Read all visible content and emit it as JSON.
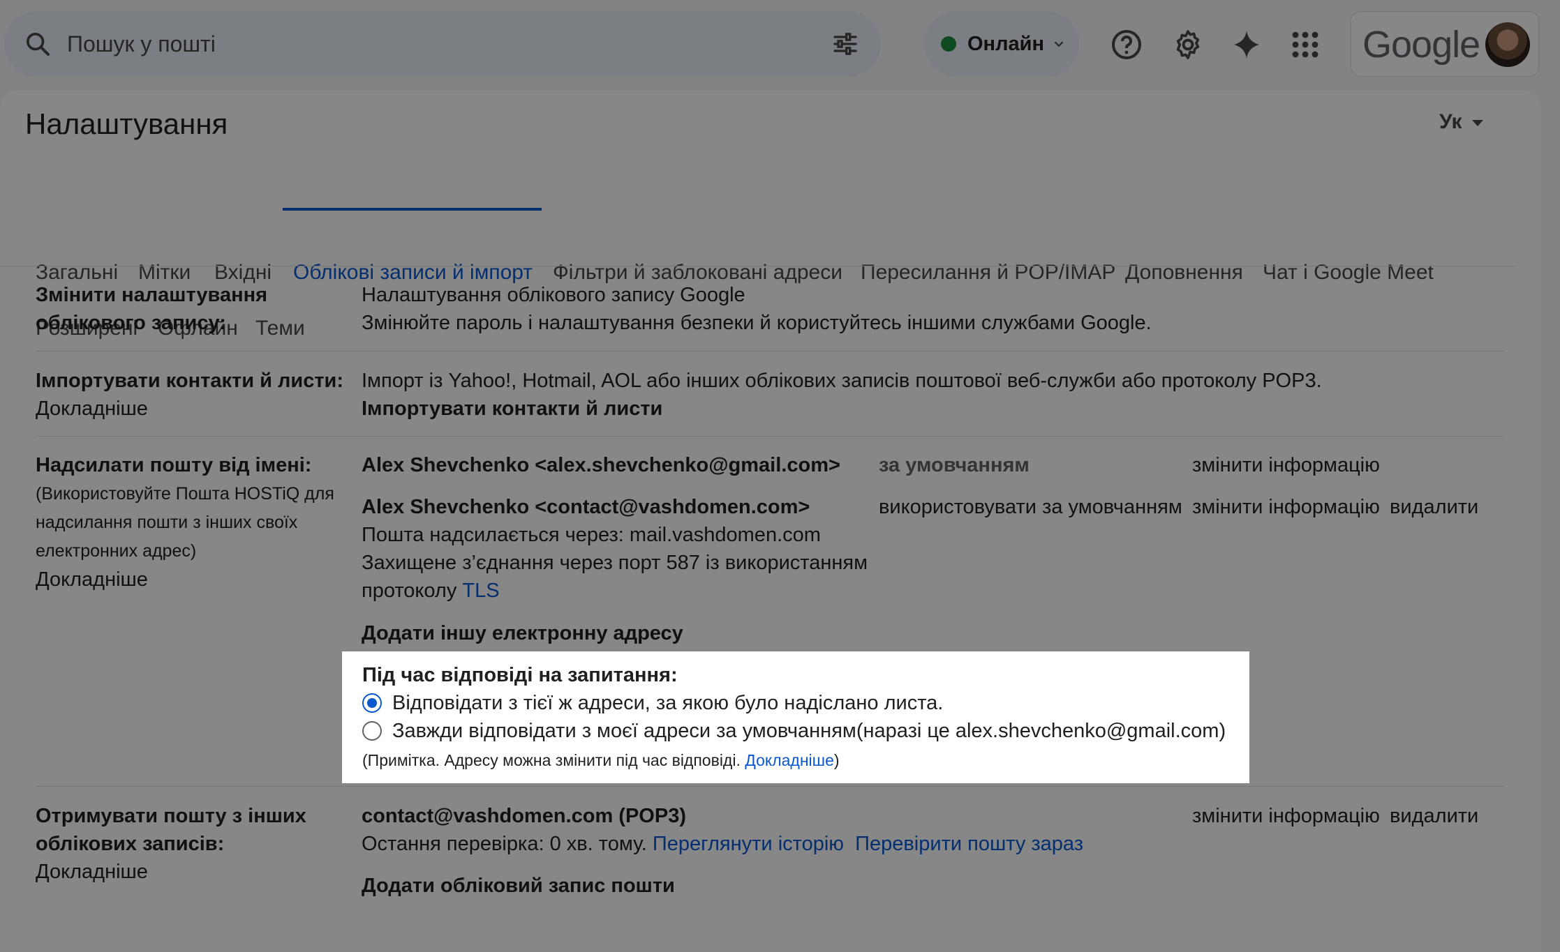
{
  "search": {
    "placeholder": "Пошук у пошті"
  },
  "status": {
    "label": "Онлайн"
  },
  "account": {
    "logo_text": "Google"
  },
  "settings": {
    "title": "Налаштування",
    "language": "Ук"
  },
  "tabs": [
    {
      "label": "Загальні"
    },
    {
      "label": "Мітки"
    },
    {
      "label": "Вхідні"
    },
    {
      "label": "Облікові записи й імпорт"
    },
    {
      "label": "Фільтри й заблоковані адреси"
    },
    {
      "label": "Пересилання й POP/IMAP"
    },
    {
      "label": "Доповнення"
    },
    {
      "label": "Чат і Google Meet"
    },
    {
      "label": "Розширені"
    },
    {
      "label": "Офлайн"
    },
    {
      "label": "Теми"
    }
  ],
  "change_account": {
    "label_line1": "Змінити налаштування",
    "label_line2": "облікового запису:",
    "link": "Налаштування облікового запису Google",
    "description": "Змінюйте пароль і налаштування безпеки й користуйтесь іншими службами Google."
  },
  "import": {
    "label": "Імпортувати контакти й листи:",
    "learn_more": "Докладніше",
    "description": "Імпорт із Yahoo!, Hotmail, AOL або інших облікових записів поштової веб-служби або протоколу POP3.",
    "action": "Імпортувати контакти й листи"
  },
  "send_as": {
    "label": "Надсилати пошту від імені:",
    "hint_line1": "(Використовуйте Пошта HOSTiQ для",
    "hint_line2": "надсилання пошти з інших своїх",
    "hint_line3": "електронних адрес)",
    "learn_more": "Докладніше",
    "addresses": [
      {
        "address": "Alex Shevchenko <alex.shevchenko@gmail.com>",
        "default_label": "за умовчанням",
        "edit": "змінити інформацію"
      },
      {
        "address": "Alex Shevchenko <contact@vashdomen.com>",
        "make_default": "використовувати за умовчанням",
        "edit": "змінити інформацію",
        "delete": "видалити",
        "via": "Пошта надсилається через: mail.vashdomen.com",
        "secure_line1": "Захищене з’єднання через порт 587 із використанням",
        "secure_line2": "протоколу",
        "tls": "TLS"
      }
    ],
    "add_address": "Додати іншу електронну адресу"
  },
  "reply": {
    "title": "Під час відповіді на запитання:",
    "option_same": "Відповідати з тієї ж адреси, за якою було надіслано листа.",
    "option_default": "Завжди відповідати з моєї адреси за умовчанням(наразі це alex.shevchenko@gmail.com)",
    "note_prefix": "(Примітка. Адресу можна змінити під час відповіді.",
    "note_link": "Докладніше",
    "note_suffix": ")",
    "selected": "option_same"
  },
  "check_mail": {
    "label_line1": "Отримувати пошту з інших",
    "label_line2": "облікових записів:",
    "learn_more": "Докладніше",
    "account": "contact@vashdomen.com (POP3)",
    "last_check": "Остання перевірка: 0 хв. тому.",
    "history": "Переглянути історію",
    "check_now": "Перевірити пошту зараз",
    "edit": "змінити інформацію",
    "delete": "видалити",
    "add_account": "Додати обліковий запис пошти"
  },
  "colors": {
    "accent": "#0b57d0",
    "online": "#1e8e3e"
  }
}
